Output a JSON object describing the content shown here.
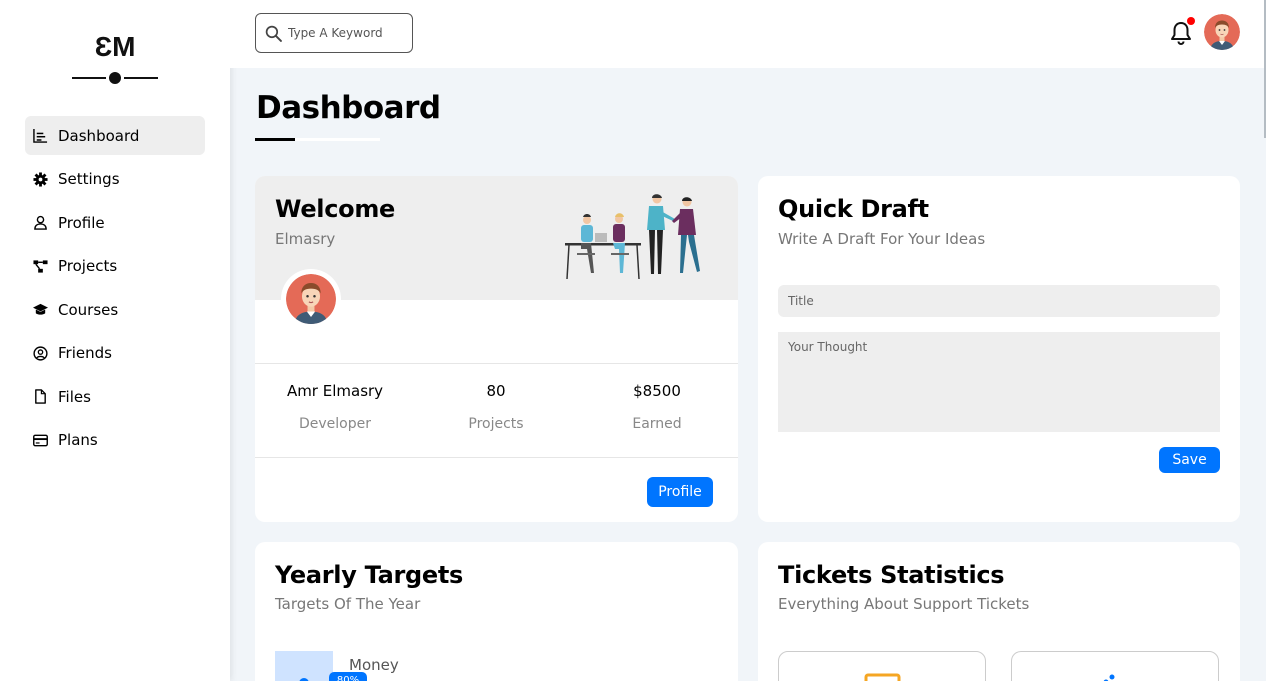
{
  "brand": {
    "logo_text": "EM"
  },
  "sidebar": {
    "items": [
      {
        "label": "Dashboard",
        "icon": "chart-icon",
        "active": true
      },
      {
        "label": "Settings",
        "icon": "gear-icon",
        "active": false
      },
      {
        "label": "Profile",
        "icon": "user-icon",
        "active": false
      },
      {
        "label": "Projects",
        "icon": "diagram-icon",
        "active": false
      },
      {
        "label": "Courses",
        "icon": "graduation-cap-icon",
        "active": false
      },
      {
        "label": "Friends",
        "icon": "user-circle-icon",
        "active": false
      },
      {
        "label": "Files",
        "icon": "file-icon",
        "active": false
      },
      {
        "label": "Plans",
        "icon": "credit-card-icon",
        "active": false
      }
    ]
  },
  "header": {
    "search_placeholder": "Type A Keyword",
    "notification_dot_color": "#ff0000"
  },
  "page": {
    "title": "Dashboard"
  },
  "welcome": {
    "title": "Welcome",
    "subtitle": "Elmasry",
    "stats": [
      {
        "value": "Amr Elmasry",
        "label": "Developer"
      },
      {
        "value": "80",
        "label": "Projects"
      },
      {
        "value": "$8500",
        "label": "Earned"
      }
    ],
    "button_label": "Profile"
  },
  "quick_draft": {
    "title": "Quick Draft",
    "subtitle": "Write A Draft For Your Ideas",
    "title_placeholder": "Title",
    "thought_placeholder": "Your Thought",
    "button_label": "Save"
  },
  "yearly_targets": {
    "title": "Yearly Targets",
    "subtitle": "Targets Of The Year",
    "items": [
      {
        "label": "Money",
        "badge": "80%"
      }
    ]
  },
  "tickets": {
    "title": "Tickets Statistics",
    "subtitle": "Everything About Support Tickets"
  },
  "colors": {
    "accent": "#0075ff",
    "background": "#f1f5f9",
    "card": "#ffffff",
    "muted": "#eeeeee"
  }
}
